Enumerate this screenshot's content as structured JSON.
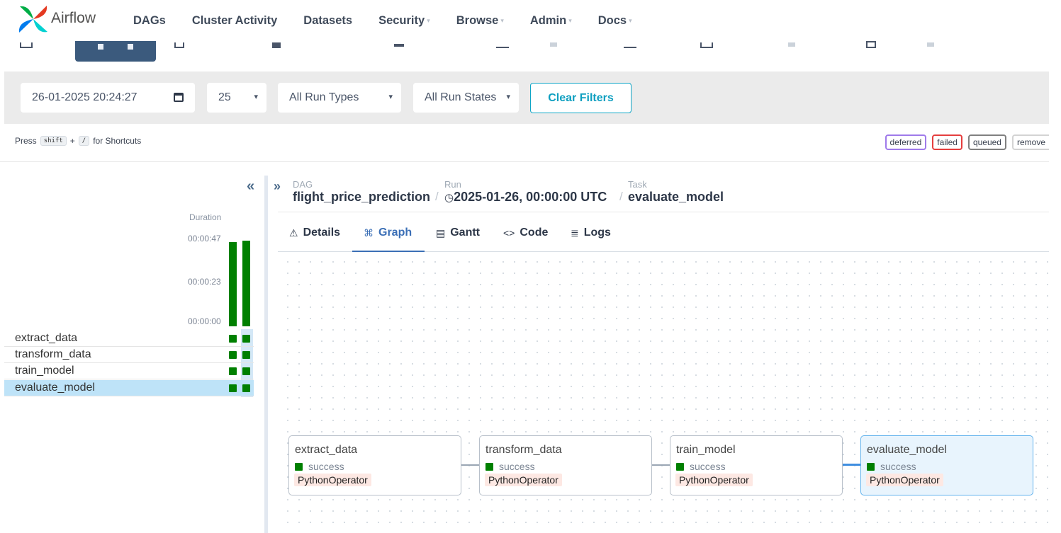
{
  "nav": {
    "brand": "Airflow",
    "items": [
      {
        "label": "DAGs",
        "dropdown": false
      },
      {
        "label": "Cluster Activity",
        "dropdown": false
      },
      {
        "label": "Datasets",
        "dropdown": false
      },
      {
        "label": "Security",
        "dropdown": true
      },
      {
        "label": "Browse",
        "dropdown": true
      },
      {
        "label": "Admin",
        "dropdown": true
      },
      {
        "label": "Docs",
        "dropdown": true
      }
    ]
  },
  "filters": {
    "date_value": "26-01-2025 20:24:27",
    "page_size": "25",
    "run_types": "All Run Types",
    "run_states": "All Run States",
    "clear_label": "Clear Filters"
  },
  "shortcuts": {
    "press": "Press",
    "key1": "shift",
    "plus": "+",
    "key2": "/",
    "suffix": "for Shortcuts"
  },
  "legend": [
    {
      "label": "deferred",
      "color": "#9f7aea"
    },
    {
      "label": "failed",
      "color": "#e53e3e"
    },
    {
      "label": "queued",
      "color": "#808080"
    },
    {
      "label": "remove",
      "color": "#d3d3d3"
    }
  ],
  "grid": {
    "duration_label": "Duration",
    "ticks": [
      "00:00:47",
      "00:00:23",
      "00:00:00"
    ],
    "run_durations": [
      1.0,
      1.02
    ],
    "tasks": [
      "extract_data",
      "transform_data",
      "train_model",
      "evaluate_model"
    ],
    "selected_task": "evaluate_model"
  },
  "breadcrumb": {
    "dag_label": "DAG",
    "dag": "flight_price_prediction",
    "run_label": "Run",
    "run": "2025-01-26, 00:00:00 UTC",
    "task_label": "Task",
    "task": "evaluate_model"
  },
  "tabs": [
    {
      "label": "Details",
      "icon": "warning-icon"
    },
    {
      "label": "Graph",
      "icon": "graph-icon",
      "active": true
    },
    {
      "label": "Gantt",
      "icon": "gantt-icon"
    },
    {
      "label": "Code",
      "icon": "code-icon"
    },
    {
      "label": "Logs",
      "icon": "logs-icon"
    }
  ],
  "graph": {
    "nodes": [
      {
        "name": "extract_data",
        "state": "success",
        "operator": "PythonOperator"
      },
      {
        "name": "transform_data",
        "state": "success",
        "operator": "PythonOperator"
      },
      {
        "name": "train_model",
        "state": "success",
        "operator": "PythonOperator"
      },
      {
        "name": "evaluate_model",
        "state": "success",
        "operator": "PythonOperator"
      }
    ]
  },
  "colors": {
    "success": "#008000",
    "accent": "#3b6fb6",
    "nav_active": "#3b5a7d",
    "clear_filters": "#0e9fc0"
  }
}
